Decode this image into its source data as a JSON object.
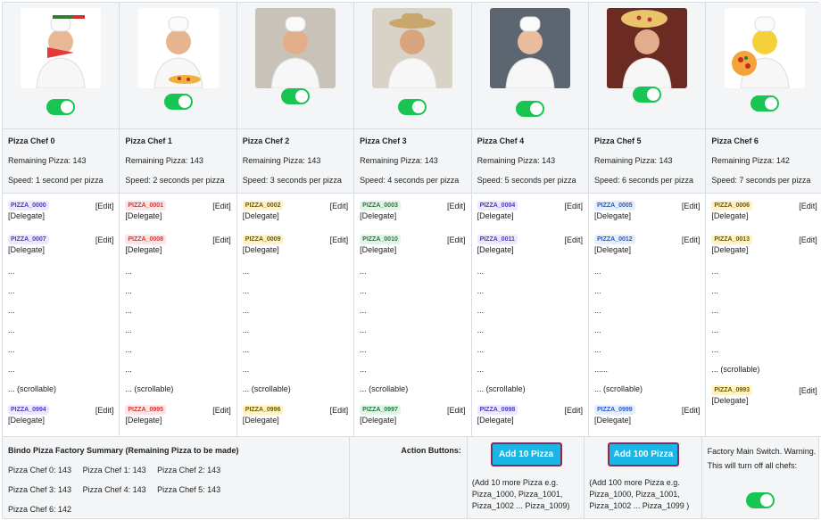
{
  "chefs": [
    {
      "name": "Pizza Chef 0",
      "remaining": "Remaining Pizza: 143",
      "speed": "Speed: 1 second per pizza",
      "first": [
        {
          "code": "PIZZA_0000",
          "edit": "[Edit]",
          "delegate": "[Delegate]"
        },
        {
          "code": "PIZZA_0007",
          "edit": "[Edit]",
          "delegate": "[Delegate]"
        }
      ],
      "dots": [
        "...",
        "...",
        "...",
        "...",
        "...",
        "..."
      ],
      "scroll": "... (scrollable)",
      "last": {
        "code": "PIZZA_0994",
        "edit": "[Edit]",
        "delegate": "[Delegate]"
      }
    },
    {
      "name": "Pizza Chef 1",
      "remaining": "Remaining Pizza: 143",
      "speed": "Speed: 2 seconds per pizza",
      "first": [
        {
          "code": "PIZZA_0001",
          "edit": "[Edit]",
          "delegate": "[Delegate]"
        },
        {
          "code": "PIZZA_0008",
          "edit": "[Edit]",
          "delegate": "[Delegate]"
        }
      ],
      "dots": [
        "...",
        "...",
        "...",
        "...",
        "...",
        "..."
      ],
      "scroll": "... (scrollable)",
      "last": {
        "code": "PIZZA_0995",
        "edit": "[Edit]",
        "delegate": "[Delegate]"
      }
    },
    {
      "name": "Pizza Chef 2",
      "remaining": "Remaining Pizza: 143",
      "speed": "Speed: 3 seconds per pizza",
      "first": [
        {
          "code": "PIZZA_0002",
          "edit": "[Edit]",
          "delegate": "[Delegate]"
        },
        {
          "code": "PIZZA_0009",
          "edit": "[Edit]",
          "delegate": "[Delegate]"
        }
      ],
      "dots": [
        "...",
        "...",
        "...",
        "...",
        "...",
        "..."
      ],
      "scroll": "... (scrollable)",
      "last": {
        "code": "PIZZA_0996",
        "edit": "[Edit]",
        "delegate": "[Delegate]"
      }
    },
    {
      "name": "Pizza Chef 3",
      "remaining": "Remaining Pizza: 143",
      "speed": "Speed: 4 seconds per pizza",
      "first": [
        {
          "code": "PIZZA_0003",
          "edit": "[Edit]",
          "delegate": "[Delegate]"
        },
        {
          "code": "PIZZA_0010",
          "edit": "[Edit]",
          "delegate": "[Delegate]"
        }
      ],
      "dots": [
        "...",
        "...",
        "...",
        "...",
        "...",
        "..."
      ],
      "scroll": "... (scrollable)",
      "last": {
        "code": "PIZZA_0997",
        "edit": "[Edit]",
        "delegate": "[Delegate]"
      }
    },
    {
      "name": "Pizza Chef 4",
      "remaining": "Remaining Pizza: 143",
      "speed": "Speed: 5 seconds per pizza",
      "first": [
        {
          "code": "PIZZA_0004",
          "edit": "[Edit]",
          "delegate": "[Delegate]"
        },
        {
          "code": "PIZZA_0011",
          "edit": "[Edit]",
          "delegate": "[Delegate]"
        }
      ],
      "dots": [
        "...",
        "...",
        "...",
        "...",
        "...",
        "..."
      ],
      "scroll": "... (scrollable)",
      "last": {
        "code": "PIZZA_0998",
        "edit": "[Edit]",
        "delegate": "[Delegate]"
      }
    },
    {
      "name": "Pizza Chef 5",
      "remaining": "Remaining Pizza: 143",
      "speed": "Speed: 6 seconds per pizza",
      "first": [
        {
          "code": "PIZZA_0005",
          "edit": "[Edit]",
          "delegate": "[Delegate]"
        },
        {
          "code": "PIZZA_0012",
          "edit": "[Edit]",
          "delegate": "[Delegate]"
        }
      ],
      "dots": [
        "...",
        "...",
        "...",
        "...",
        "...",
        "......"
      ],
      "scroll": "... (scrollable)",
      "last": {
        "code": "PIZZA_0999",
        "edit": "[Edit]",
        "delegate": "[Delegate]"
      }
    },
    {
      "name": "Pizza Chef 6",
      "remaining": "Remaining Pizza: 142",
      "speed": "Speed: 7 seconds per pizza",
      "first": [
        {
          "code": "PIZZA_0006",
          "edit": "[Edit]",
          "delegate": "[Delegate]"
        },
        {
          "code": "PIZZA_0013",
          "edit": "[Edit]",
          "delegate": "[Delegate]"
        }
      ],
      "dots": [
        "...",
        "...",
        "...",
        "...",
        "...",
        "... (scrollable)"
      ],
      "scroll": "",
      "last": {
        "code": "PIZZA_0993",
        "edit": "[Edit]",
        "delegate": "[Delegate]"
      }
    }
  ],
  "badge_colors": [
    "purple",
    "red",
    "yellow",
    "green",
    "purple",
    "blue",
    "yellow"
  ],
  "toggle_color": "#19c552",
  "summary": {
    "title": "Bindo Pizza Factory Summary (Remaining Pizza to be made)",
    "row1": [
      "Pizza Chef 0: 143",
      "Pizza Chef 1: 143",
      "Pizza Chef 2: 143"
    ],
    "row2": [
      "Pizza Chef 3: 143",
      "Pizza Chef 4: 143",
      "Pizza Chef 5: 143"
    ],
    "row3": [
      "Pizza Chef 6: 142"
    ]
  },
  "actions": {
    "label": "Action Buttons:",
    "add10": "Add 10 Pizza",
    "add10_note": "(Add 10 more Pizza e.g. Pizza_1000, Pizza_1001, Pizza_1002 ... Pizza_1009)",
    "add100": "Add 100 Pizza",
    "add100_note": "(Add 100 more Pizza e.g. Pizza_1000, Pizza_1001, Pizza_1002 ... Pizza_1099 )"
  },
  "main_switch": {
    "text": "Factory Main Switch. Warning. This will turn off all chefs:"
  }
}
